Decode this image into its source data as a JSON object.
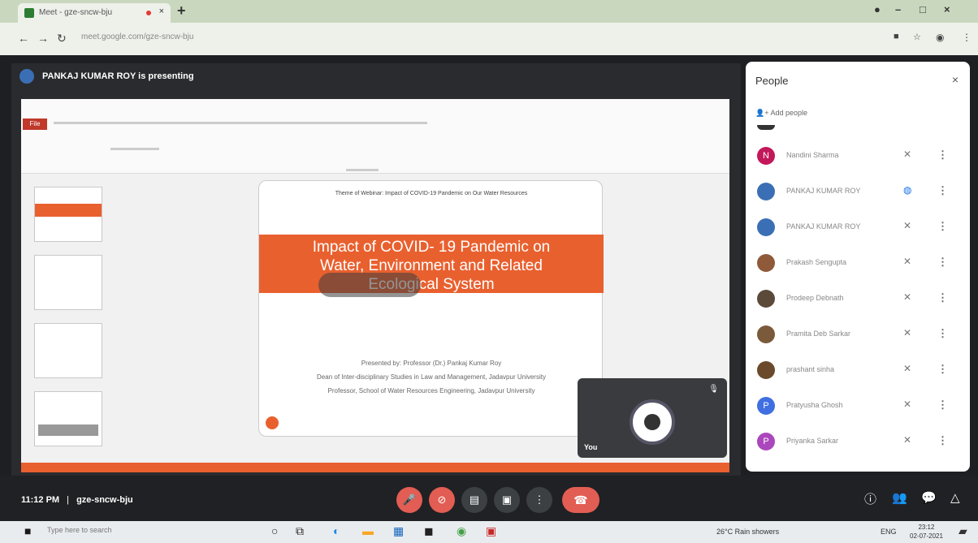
{
  "browser": {
    "tab_title": "Meet - gze-sncw-bju",
    "new_tab": "+",
    "url": "meet.google.com/gze-sncw-bju"
  },
  "presenter": {
    "text": "PANKAJ KUMAR ROY is presenting"
  },
  "slide": {
    "header": "Theme of Webinar: Impact of COVID-19 Pandemic on Our Water Resources",
    "title_lines": [
      "Impact of COVID- 19 Pandemic on",
      "Water, Environment and Related",
      "Ecological System"
    ],
    "byline_lines": [
      "Presented by: Professor (Dr.) Pankaj Kumar Roy",
      "Dean of Inter-disciplinary Studies in Law and Management, Jadavpur University",
      "Professor, School of Water Resources Engineering, Jadavpur University"
    ]
  },
  "self_tile": {
    "label": "You"
  },
  "people": {
    "title": "People",
    "close": "×",
    "add_label": "Add people",
    "list": [
      {
        "initial": "N",
        "name": "Nandini Sharma",
        "color": "#c2185b",
        "mic": "muted"
      },
      {
        "initial": "",
        "name": "PANKAJ KUMAR ROY",
        "color": "#3b6fb5",
        "mic": "speaking"
      },
      {
        "initial": "",
        "name": "PANKAJ KUMAR ROY",
        "color": "#3b6fb5",
        "mic": "muted"
      },
      {
        "initial": "",
        "name": "Prakash Sengupta",
        "color": "#8e5a3a",
        "mic": "muted"
      },
      {
        "initial": "",
        "name": "Prodeep Debnath",
        "color": "#5b4a3a",
        "mic": "muted"
      },
      {
        "initial": "",
        "name": "Pramita Deb Sarkar",
        "color": "#7a5a3a",
        "mic": "muted"
      },
      {
        "initial": "",
        "name": "prashant sinha",
        "color": "#6a4a2a",
        "mic": "muted"
      },
      {
        "initial": "P",
        "name": "Pratyusha Ghosh",
        "color": "#3f6fe0",
        "mic": "muted"
      },
      {
        "initial": "P",
        "name": "Priyanka Sarkar",
        "color": "#ab47bc",
        "mic": "muted"
      }
    ]
  },
  "bottom": {
    "time": "11:12 PM",
    "separator": "|",
    "code": "gze-sncw-bju"
  },
  "taskbar": {
    "search_placeholder": "Type here to search",
    "weather": "26°C Rain showers",
    "time": "23:12",
    "date": "02-07-2021",
    "lang": "ENG"
  }
}
